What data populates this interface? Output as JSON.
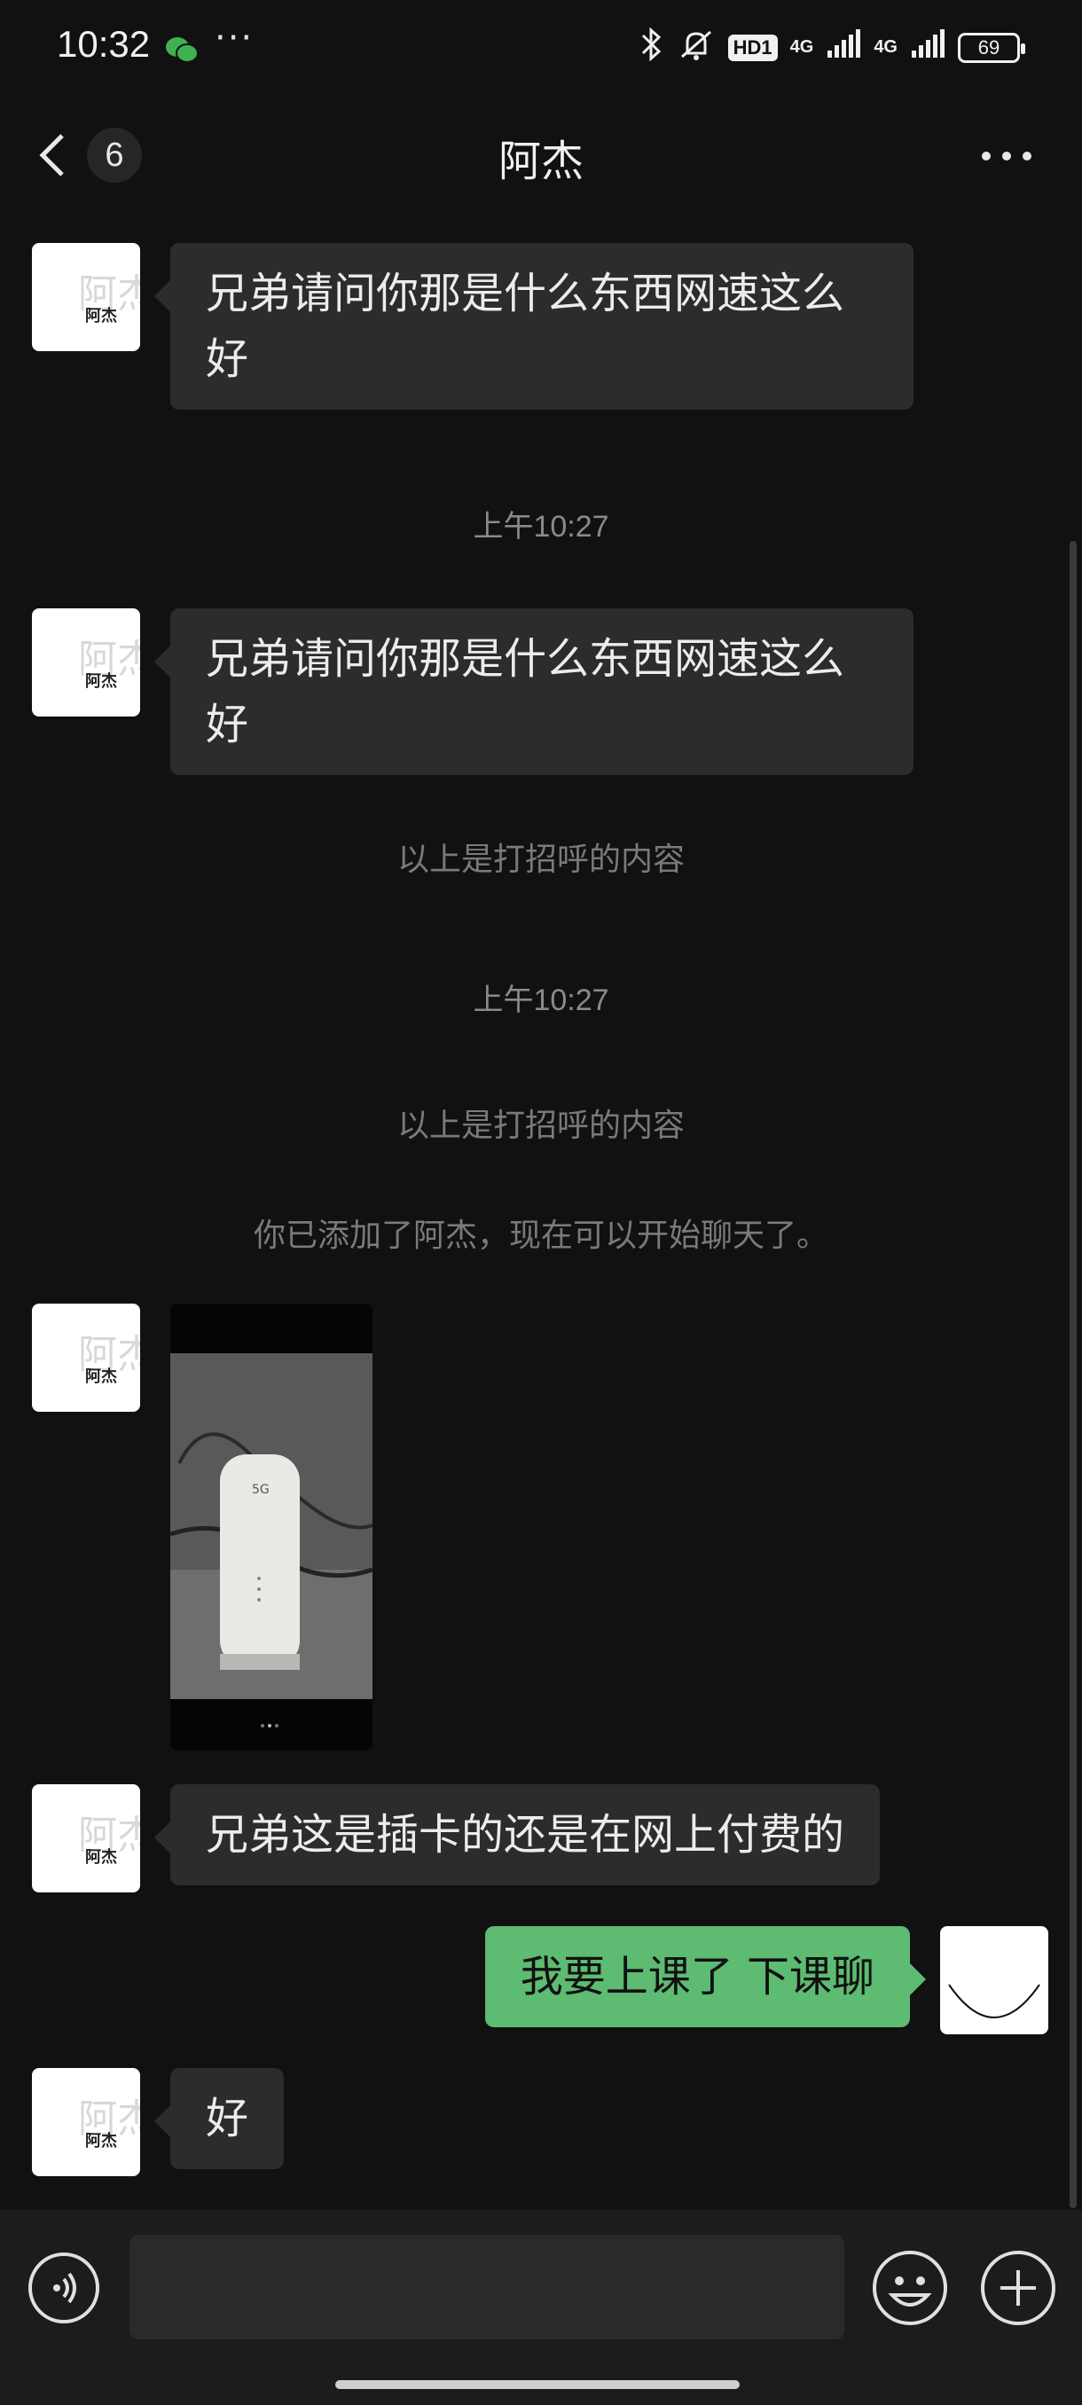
{
  "status_bar": {
    "time": "10:32",
    "dots": "···",
    "hd": "HD1",
    "net1": "4G",
    "net2": "4G",
    "battery": "69"
  },
  "nav": {
    "back_count": "6",
    "title": "阿杰"
  },
  "contact_avatar_text": "阿杰",
  "messages": [
    {
      "type": "text",
      "side": "left",
      "text": "兄弟请问你那是什么东西网速这么好"
    },
    {
      "type": "time",
      "text": "上午10:27"
    },
    {
      "type": "text",
      "side": "left",
      "text": "兄弟请问你那是什么东西网速这么好"
    },
    {
      "type": "system",
      "text": "以上是打招呼的内容"
    },
    {
      "type": "time",
      "text": "上午10:27"
    },
    {
      "type": "system",
      "text": "以上是打招呼的内容"
    },
    {
      "type": "system",
      "text": "你已添加了阿杰，现在可以开始聊天了。"
    },
    {
      "type": "image",
      "side": "left",
      "text": "5G"
    },
    {
      "type": "text",
      "side": "left",
      "text": "兄弟这是插卡的还是在网上付费的"
    },
    {
      "type": "text",
      "side": "right",
      "text": "我要上课了 下课聊"
    },
    {
      "type": "text",
      "side": "left",
      "text": "好"
    }
  ],
  "input": {
    "placeholder": ""
  },
  "colors": {
    "background": "#111111",
    "bubble_left": "#2c2c2c",
    "bubble_right": "#5dbb72",
    "input_bar": "#1c1c1c"
  }
}
